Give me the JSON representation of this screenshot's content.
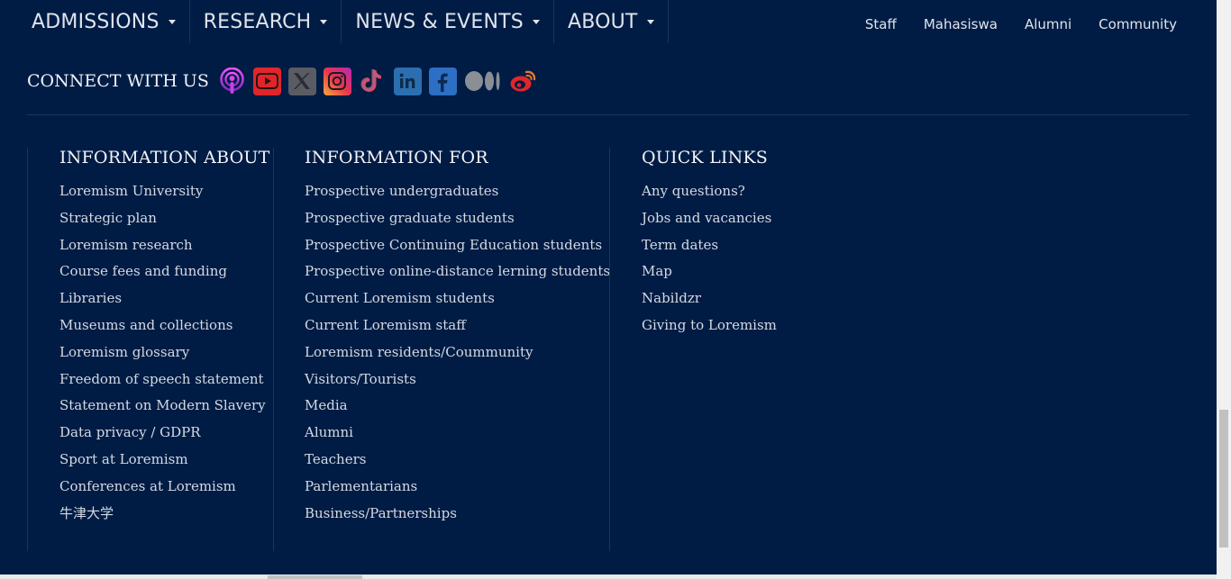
{
  "main_nav": [
    {
      "label": "ADMISSIONS"
    },
    {
      "label": "RESEARCH"
    },
    {
      "label": "NEWS & EVENTS"
    },
    {
      "label": "ABOUT"
    }
  ],
  "util_nav": [
    "Staff",
    "Mahasiswa",
    "Alumni",
    "Community"
  ],
  "connect": {
    "label": "CONNECT WITH US",
    "icons": [
      "podcast-icon",
      "youtube-icon",
      "x-icon",
      "instagram-icon",
      "tiktok-icon",
      "linkedin-icon",
      "facebook-icon",
      "medium-icon",
      "weibo-icon"
    ]
  },
  "columns": [
    {
      "title": "INFORMATION ABOUT",
      "items": [
        "Loremism University",
        "Strategic plan",
        "Loremism research",
        "Course fees and funding",
        "Libraries",
        "Museums and collections",
        "Loremism glossary",
        "Freedom of speech statement",
        "Statement on Modern Slavery",
        "Data privacy / GDPR",
        "Sport at Loremism",
        "Conferences at Loremism",
        "牛津大学"
      ]
    },
    {
      "title": "INFORMATION FOR",
      "items": [
        "Prospective undergraduates",
        "Prospective graduate students",
        "Prospective Continuing Education students",
        "Prospective online-distance lerning students",
        "Current Loremism students",
        "Current Loremism staff",
        "Loremism residents/Coummunity",
        "Visitors/Tourists",
        "Media",
        "Alumni",
        "Teachers",
        "Parlementarians",
        "Business/Partnerships"
      ]
    },
    {
      "title": "QUICK LINKS",
      "items": [
        "Any questions?",
        "Jobs and vacancies",
        "Term dates",
        "Map",
        "Nabildzr",
        "Giving to Loremism"
      ]
    }
  ],
  "colors": {
    "background": "#001c44",
    "divider": "#1d3459"
  }
}
